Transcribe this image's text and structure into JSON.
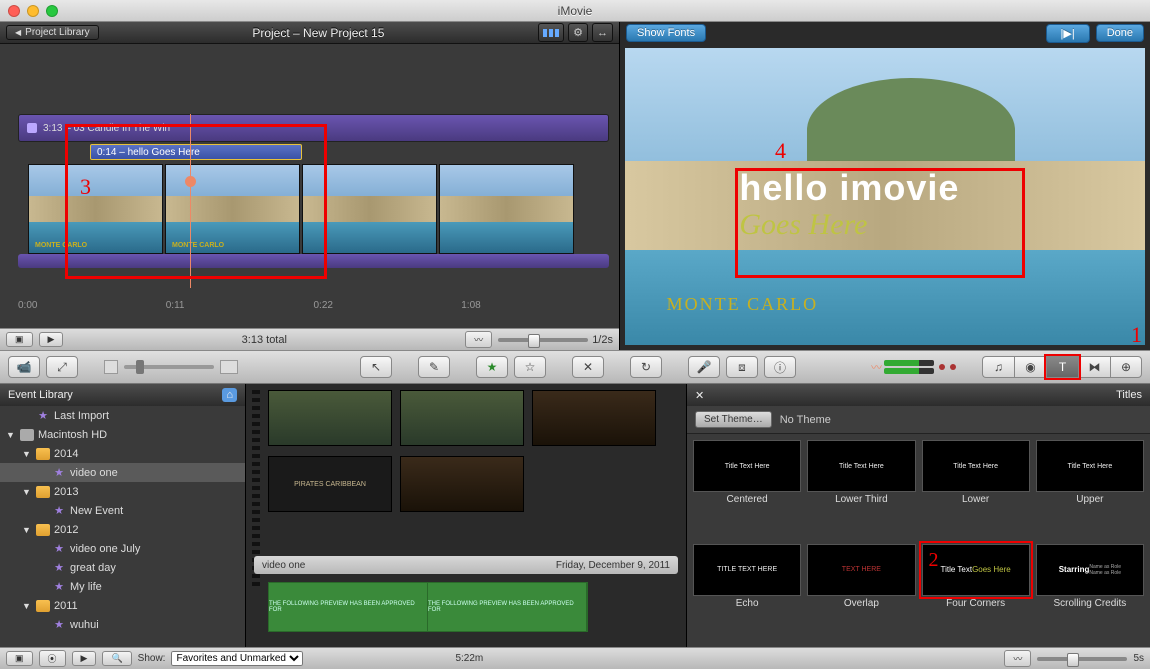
{
  "app_title": "iMovie",
  "project": {
    "library_btn": "Project Library",
    "title": "Project – New Project 15",
    "audio_track_label": "3:13 – 03 Candle In The Win",
    "title_chip": "0:14 – hello   Goes Here",
    "thumb_caption": "MONTE CARLO",
    "ruler": [
      "0:00",
      "0:11",
      "0:22",
      "1:08"
    ],
    "total": "3:13 total",
    "zoom_label": "1/2s"
  },
  "preview": {
    "show_fonts": "Show Fonts",
    "play_btn": "▶",
    "done": "Done",
    "title_main": "hello  imovie",
    "title_sub": "Goes Here",
    "caption": "MONTE CARLO"
  },
  "annotations": {
    "n1": "1",
    "n2": "2",
    "n3": "3",
    "n4": "4"
  },
  "midbar": {
    "camera": "camera",
    "swap": "swap",
    "arrow": "arrow",
    "wand": "wand",
    "star_f": "star-fill",
    "star_o": "star-outline",
    "x": "x",
    "loop": "loop",
    "mic": "mic",
    "crop": "crop",
    "info": "info",
    "music": "music",
    "photo": "photo",
    "title": "title",
    "trans": "trans",
    "map": "map"
  },
  "event_lib": {
    "header": "Event Library",
    "rows": [
      {
        "indent": 1,
        "tri": "",
        "icon": "star",
        "label": "Last Import"
      },
      {
        "indent": 0,
        "tri": "▼",
        "icon": "hd",
        "label": "Macintosh HD"
      },
      {
        "indent": 1,
        "tri": "▼",
        "icon": "cal",
        "label": "2014"
      },
      {
        "indent": 2,
        "tri": "",
        "icon": "star",
        "label": "video one",
        "sel": true
      },
      {
        "indent": 1,
        "tri": "▼",
        "icon": "cal",
        "label": "2013"
      },
      {
        "indent": 2,
        "tri": "",
        "icon": "star",
        "label": "New Event"
      },
      {
        "indent": 1,
        "tri": "▼",
        "icon": "cal",
        "label": "2012"
      },
      {
        "indent": 2,
        "tri": "",
        "icon": "star",
        "label": "video one July"
      },
      {
        "indent": 2,
        "tri": "",
        "icon": "star",
        "label": "great day"
      },
      {
        "indent": 2,
        "tri": "",
        "icon": "star",
        "label": "My life"
      },
      {
        "indent": 1,
        "tri": "▼",
        "icon": "cal",
        "label": "2011"
      },
      {
        "indent": 2,
        "tri": "",
        "icon": "star",
        "label": "wuhui"
      }
    ]
  },
  "event_clips": {
    "poster": "PIRATES CARIBBEAN",
    "label_left": "video one",
    "label_right": "Friday, December 9, 2011",
    "green_text": "THE FOLLOWING PREVIEW HAS BEEN APPROVED FOR"
  },
  "titles_panel": {
    "header": "Titles",
    "set_theme": "Set Theme…",
    "no_theme": "No Theme",
    "tiles": [
      {
        "label": "Centered",
        "txt": "Title Text Here"
      },
      {
        "label": "Lower Third",
        "txt": "Title Text Here"
      },
      {
        "label": "Lower",
        "txt": "Title Text Here"
      },
      {
        "label": "Upper",
        "txt": "Title Text Here"
      },
      {
        "label": "Echo",
        "txt": "TITLE TEXT HERE"
      },
      {
        "label": "Overlap",
        "txt": "TEXT HERE"
      },
      {
        "label": "Four Corners",
        "txt": "Title Text Goes Here",
        "sel": true
      },
      {
        "label": "Scrolling Credits",
        "txt": "Starring"
      }
    ]
  },
  "bottom": {
    "show": "Show:",
    "filter": "Favorites and Unmarked",
    "dur": "5:22m",
    "thumb_seconds": "5s"
  }
}
